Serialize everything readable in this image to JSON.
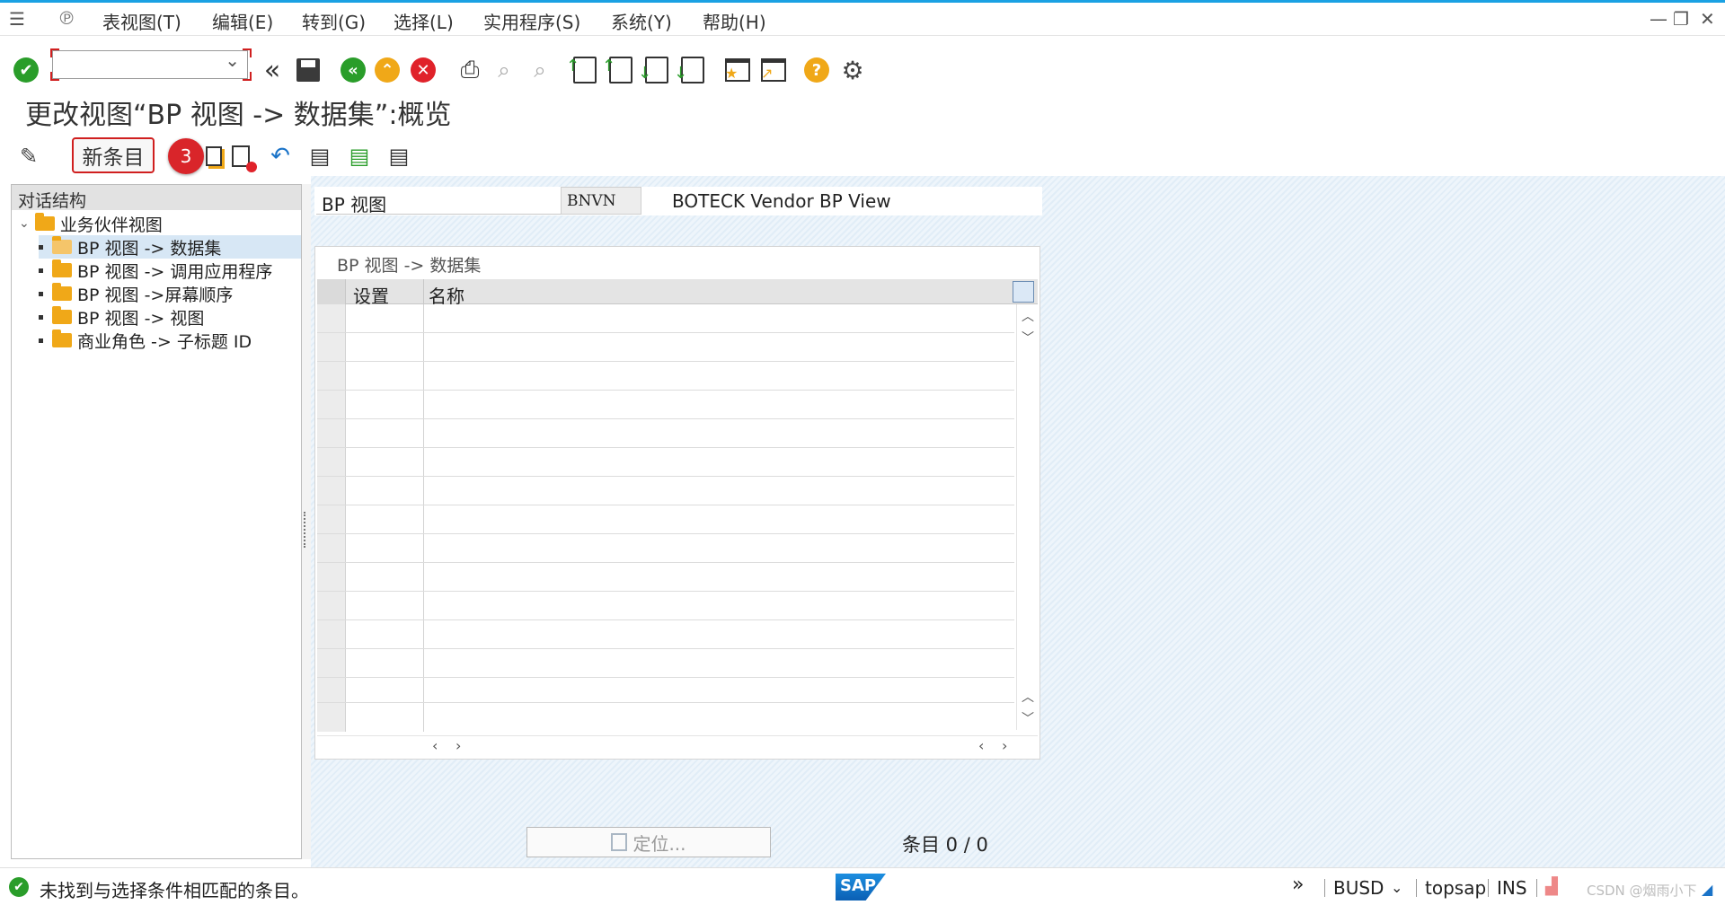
{
  "menu": {
    "items": [
      "表视图(T)",
      "编辑(E)",
      "转到(G)",
      "选择(L)",
      "实用程序(S)",
      "系统(Y)",
      "帮助(H)"
    ]
  },
  "title": "更改视图“BP 视图 -> 数据集”:概览",
  "app_toolbar": {
    "new_entry_label": "新条目",
    "step_badge": "3"
  },
  "tree": {
    "header": "对话结构",
    "root": "业务伙伴视图",
    "items": [
      "BP 视图 -> 数据集",
      "BP 视图 -> 调用应用程序",
      "BP 视图 ->屏幕顺序",
      "BP 视图 -> 视图",
      "商业角色 -> 子标题 ID"
    ],
    "selected_index": 0
  },
  "bp_view": {
    "label": "BP 视图",
    "value": "BNVN",
    "description": "BOTECK Vendor BP View"
  },
  "table": {
    "title": "BP 视图 -> 数据集",
    "columns": [
      "设置",
      "名称"
    ],
    "rows": []
  },
  "locate_label": "定位...",
  "entry_count": "条目 0 / 0",
  "status": {
    "message": "未找到与选择条件相匹配的条目。",
    "system": "BUSD",
    "client": "topsap",
    "mode": "INS",
    "watermark": "CSDN @烟雨小下"
  },
  "colors": {
    "accent_blue": "#1aa1e3",
    "highlight_red": "#d01f1f",
    "ok_green": "#2a9d2a",
    "tree_selection": "#d7e7f5"
  }
}
